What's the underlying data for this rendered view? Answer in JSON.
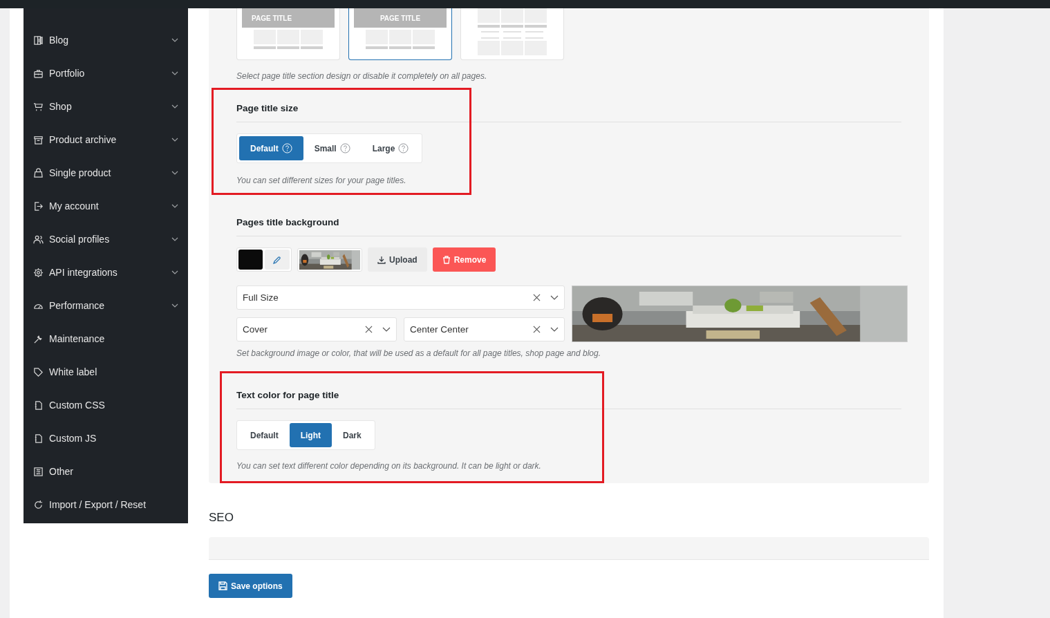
{
  "sidebar": {
    "items": [
      {
        "label": "Blog",
        "kind": "blog",
        "expandable": true
      },
      {
        "label": "Portfolio",
        "kind": "briefcase",
        "expandable": true
      },
      {
        "label": "Shop",
        "kind": "cart",
        "expandable": true
      },
      {
        "label": "Product archive",
        "kind": "archive",
        "expandable": true
      },
      {
        "label": "Single product",
        "kind": "bag",
        "expandable": true
      },
      {
        "label": "My account",
        "kind": "login",
        "expandable": true
      },
      {
        "label": "Social profiles",
        "kind": "people",
        "expandable": true
      },
      {
        "label": "API integrations",
        "kind": "gear",
        "expandable": true
      },
      {
        "label": "Performance",
        "kind": "gauge",
        "expandable": true
      },
      {
        "label": "Maintenance",
        "kind": "wrench",
        "expandable": false
      },
      {
        "label": "White label",
        "kind": "tag",
        "expandable": false
      },
      {
        "label": "Custom CSS",
        "kind": "file",
        "expandable": false
      },
      {
        "label": "Custom JS",
        "kind": "file",
        "expandable": false
      },
      {
        "label": "Other",
        "kind": "sliders",
        "expandable": false
      },
      {
        "label": "Import / Export / Reset",
        "kind": "refresh",
        "expandable": false
      }
    ]
  },
  "design_picker": {
    "options": [
      {
        "kind": "banner",
        "label": "PAGE TITLE",
        "selected": false
      },
      {
        "kind": "banner",
        "label": "PAGE TITLE",
        "selected": true
      },
      {
        "kind": "none",
        "selected": false
      }
    ],
    "help": "Select page title section design or disable it completely on all pages."
  },
  "title_size": {
    "heading": "Page title size",
    "highlighted": true,
    "options": [
      {
        "label": "Default",
        "selected": true,
        "has_help": true
      },
      {
        "label": "Small",
        "selected": false,
        "has_help": true
      },
      {
        "label": "Large",
        "selected": false,
        "has_help": true
      }
    ],
    "help": "You can set different sizes for your page titles."
  },
  "title_background": {
    "heading": "Pages title background",
    "highlighted": false,
    "color": "#0b0b0b",
    "upload": "Upload",
    "remove": "Remove",
    "size": "Full Size",
    "fit": "Cover",
    "position": "Center Center",
    "help": "Set background image or color, that will be used as a default for all page titles, shop page and blog."
  },
  "text_color": {
    "heading": "Text color for page title",
    "highlighted": true,
    "options": [
      {
        "label": "Default",
        "selected": false,
        "has_help": false
      },
      {
        "label": "Light",
        "selected": true,
        "has_help": false
      },
      {
        "label": "Dark",
        "selected": false,
        "has_help": false
      }
    ],
    "help": "You can set text different color depending on its background. It can be light or dark."
  },
  "seo": {
    "heading": "SEO"
  },
  "save_button": "Save options"
}
